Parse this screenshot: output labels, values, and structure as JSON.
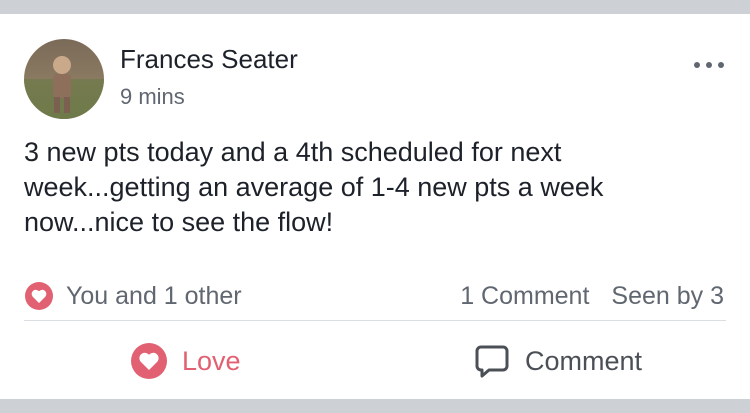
{
  "post": {
    "author": "Frances Seater",
    "time": "9 mins",
    "text": "3 new pts today and a 4th scheduled for next week...getting an average of 1-4 new pts a week now...nice to see the flow!",
    "reaction_summary": "You and 1 other",
    "reaction_icon": "heart-icon",
    "comments_count_label": "1 Comment",
    "seen_by_label": "Seen by 3"
  },
  "actions": {
    "love_label": "Love",
    "comment_label": "Comment"
  },
  "colors": {
    "love_accent": "#e16173",
    "text_primary": "#1d2129",
    "text_secondary": "#606770",
    "page_background": "#cdd0d5"
  }
}
